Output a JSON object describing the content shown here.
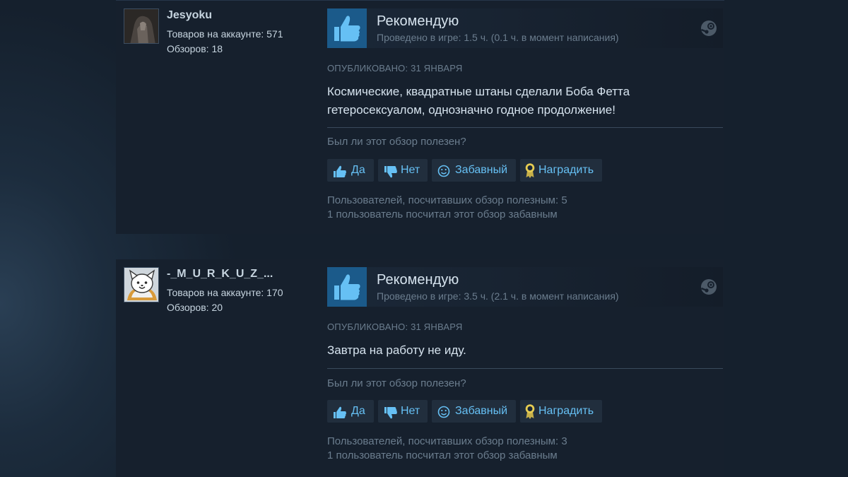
{
  "reviews": [
    {
      "author": "Jesyoku",
      "products": "Товаров на аккаунте: 571",
      "reviews_count": "Обзоров: 18",
      "verdict": "Рекомендую",
      "hours": "Проведено в игре: 1.5 ч. (0.1 ч. в момент написания)",
      "posted": "Опубликовано: 31 января",
      "text": "Космические, квадратные штаны сделали Боба Фетта гетеросексуалом, однозначно годное продолжение!",
      "helpful_question": "Был ли этот обзор полезен?",
      "buttons": {
        "yes": "Да",
        "no": "Нет",
        "funny": "Забавный",
        "award": "Наградить"
      },
      "helpful_stat": "Пользователей, посчитавших обзор полезным: 5",
      "funny_stat": "1 пользователь посчитал этот обзор забавным"
    },
    {
      "author": "-_M_U_R_K_U_Z_...",
      "products": "Товаров на аккаунте: 170",
      "reviews_count": "Обзоров: 20",
      "verdict": "Рекомендую",
      "hours": "Проведено в игре: 3.5 ч. (2.1 ч. в момент написания)",
      "posted": "Опубликовано: 31 января",
      "text": "Завтра на работу не иду.",
      "helpful_question": "Был ли этот обзор полезен?",
      "buttons": {
        "yes": "Да",
        "no": "Нет",
        "funny": "Забавный",
        "award": "Наградить"
      },
      "helpful_stat": "Пользователей, посчитавших обзор полезным: 3",
      "funny_stat": "1 пользователь посчитал этот обзор забавным"
    }
  ],
  "icons": {
    "recommend": "thumbs-up-icon",
    "platform": "steam-icon",
    "yes": "thumbs-up-icon",
    "no": "thumbs-down-icon",
    "funny": "smiley-icon",
    "award": "award-icon"
  },
  "colors": {
    "accent": "#66c0f4",
    "thumb_bg": "#1b5a8a",
    "card_bg": "#16202d"
  }
}
